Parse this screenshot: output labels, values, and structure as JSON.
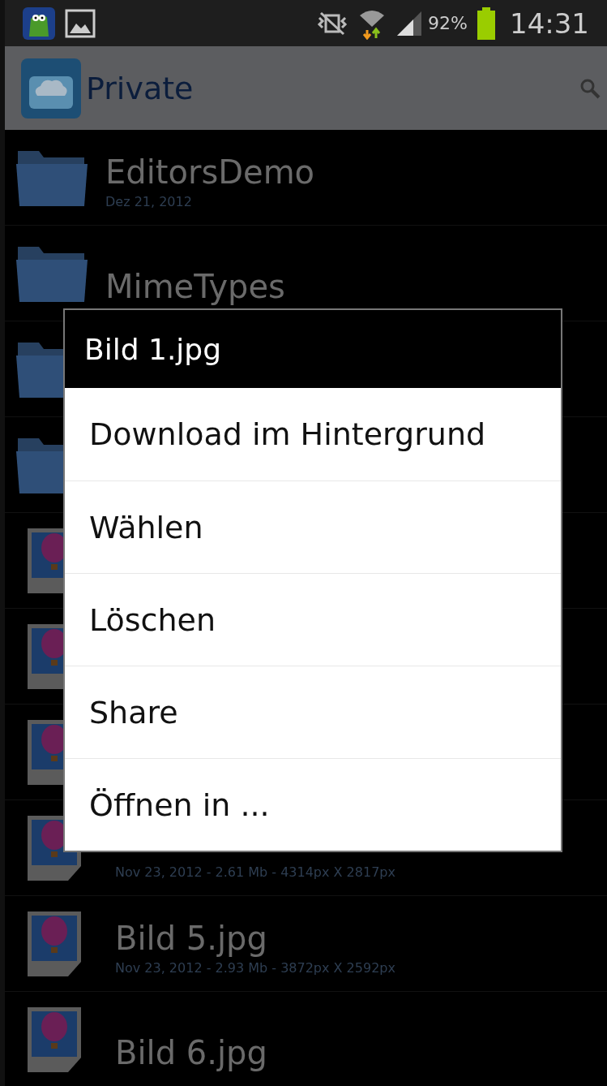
{
  "status_bar": {
    "battery": "92%",
    "time": "14:31"
  },
  "action_bar": {
    "title": "Private"
  },
  "list": [
    {
      "kind": "folder",
      "title": "EditorsDemo",
      "subtitle": "Dez 21, 2012"
    },
    {
      "kind": "folder",
      "title": "MimeTypes"
    },
    {
      "kind": "folder"
    },
    {
      "kind": "folder"
    },
    {
      "kind": "image"
    },
    {
      "kind": "image"
    },
    {
      "kind": "image"
    },
    {
      "kind": "image",
      "subtitle": "Nov 23, 2012 - 2.61 Mb - 4314px X 2817px"
    },
    {
      "kind": "image",
      "title": "Bild 5.jpg",
      "subtitle": "Nov 23, 2012 - 2.93 Mb - 3872px X 2592px"
    },
    {
      "kind": "image",
      "title": "Bild 6.jpg"
    }
  ],
  "dialog": {
    "title": "Bild 1.jpg",
    "items": [
      "Download im Hintergrund",
      "Wählen",
      "Löschen",
      "Share",
      "Öffnen in ..."
    ]
  }
}
